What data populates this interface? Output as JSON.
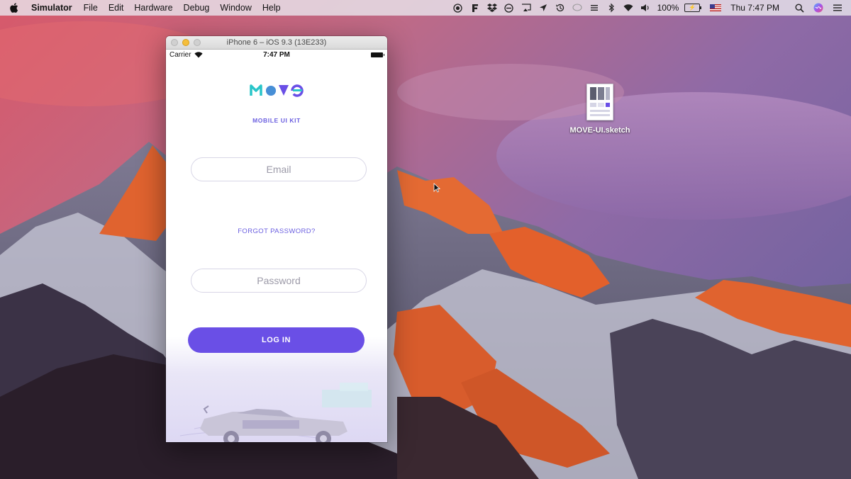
{
  "menubar": {
    "apple_icon": "apple-icon",
    "app_name": "Simulator",
    "menus": [
      "File",
      "Edit",
      "Hardware",
      "Debug",
      "Window",
      "Help"
    ],
    "status": {
      "battery_percent": "100%",
      "battery_glyph": "⚡",
      "clock": "Thu 7:47 PM",
      "icons": [
        "record-icon",
        "f-app-icon",
        "dropbox-icon",
        "no-entry-icon",
        "cast-icon",
        "location-arrow-icon",
        "time-machine-icon",
        "chat-bubble-icon",
        "bluetooth-icon",
        "wifi-icon",
        "volume-icon",
        "flag-icon",
        "search-icon",
        "siri-icon",
        "list-icon"
      ]
    }
  },
  "simulator": {
    "window_title": "iPhone 6 – iOS 9.3 (13E233)",
    "ios_status": {
      "carrier": "Carrier",
      "time": "7:47 PM"
    },
    "app": {
      "logo_text": "MOVE",
      "subtitle": "MOBILE UI KIT",
      "email_placeholder": "Email",
      "forgot_password": "FORGOT PASSWORD?",
      "password_placeholder": "Password",
      "login_label": "LOG IN"
    },
    "colors": {
      "accent": "#6a4fe6",
      "logo_teal": "#29c5c9",
      "logo_purple": "#6a4fe6"
    }
  },
  "desktop": {
    "file_name": "MOVE-UI.sketch"
  }
}
